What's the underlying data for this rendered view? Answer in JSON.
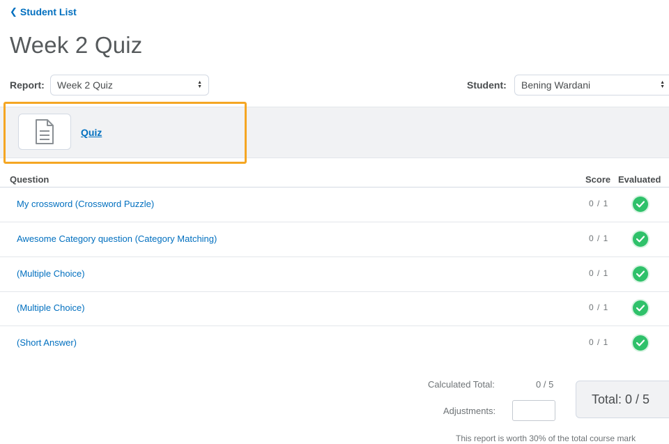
{
  "nav": {
    "back_label": "Student List"
  },
  "page": {
    "title": "Week 2 Quiz"
  },
  "filters": {
    "report_label": "Report:",
    "report_value": "Week 2 Quiz",
    "student_label": "Student:",
    "student_value": "Bening Wardani"
  },
  "activity": {
    "link_label": "Quiz",
    "icon": "document-icon"
  },
  "table": {
    "headers": {
      "question": "Question",
      "score": "Score",
      "evaluated": "Evaluated"
    },
    "rows": [
      {
        "question": "My crossword (Crossword Puzzle)",
        "score": "0 / 1",
        "evaluated": true
      },
      {
        "question": "Awesome Category question (Category Matching)",
        "score": "0 / 1",
        "evaluated": true
      },
      {
        "question": "(Multiple Choice)",
        "score": "0 / 1",
        "evaluated": true
      },
      {
        "question": "(Multiple Choice)",
        "score": "0 / 1",
        "evaluated": true
      },
      {
        "question": "(Short Answer)",
        "score": "0 / 1",
        "evaluated": true
      }
    ]
  },
  "summary": {
    "calculated_label": "Calculated Total:",
    "calculated_value": "0 / 5",
    "adjustments_label": "Adjustments:",
    "adjustments_value": "",
    "total_label": "Total: 0 / 5",
    "footnote": "This report is worth 30% of the total course mark"
  },
  "colors": {
    "link": "#006fbf",
    "highlight": "#f5a623",
    "check": "#2fc16a"
  }
}
